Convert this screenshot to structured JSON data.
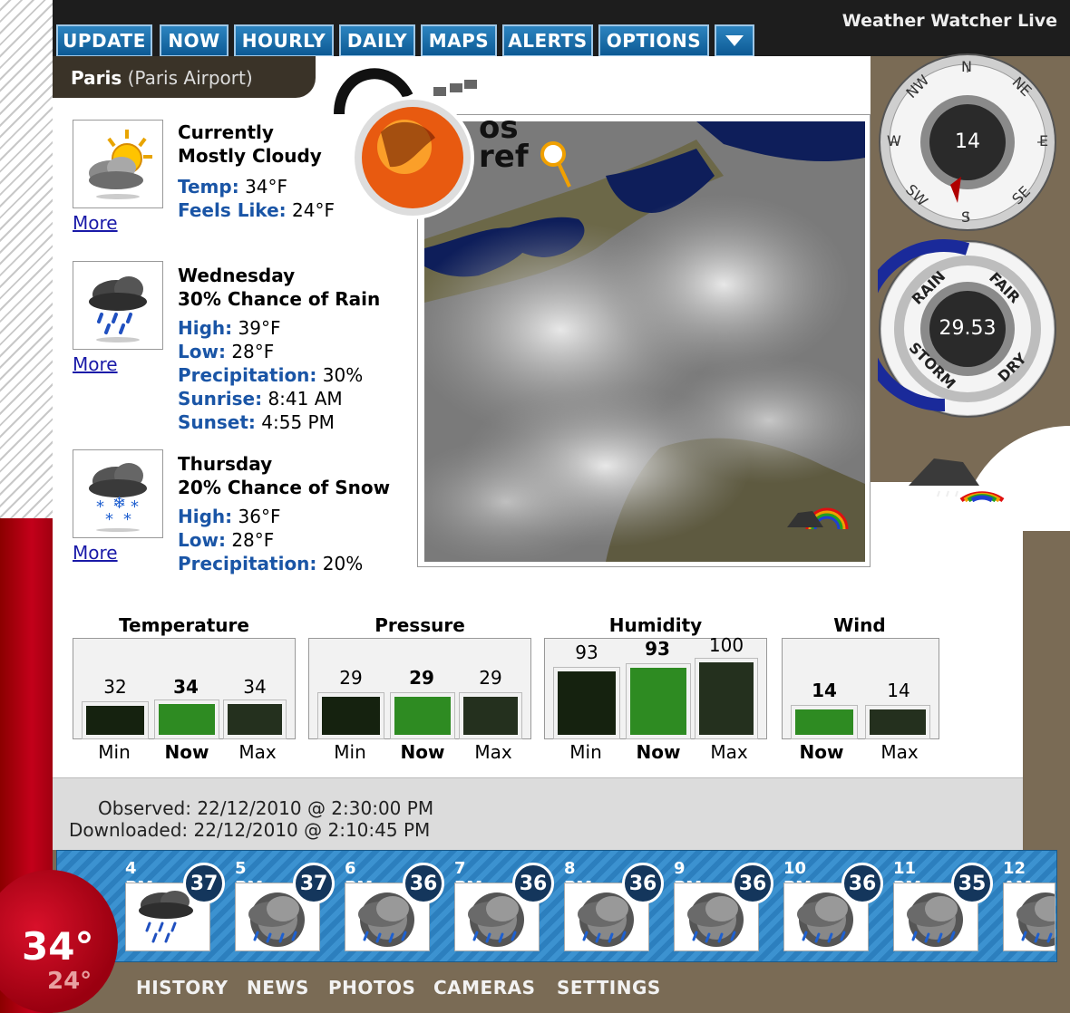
{
  "app": {
    "title": "Weather Watcher Live"
  },
  "nav": {
    "update": "UPDATE",
    "now": "NOW",
    "hourly": "HOURLY",
    "daily": "DAILY",
    "maps": "MAPS",
    "alerts": "ALERTS",
    "options": "OPTIONS"
  },
  "location": {
    "city": "Paris",
    "station": "(Paris Airport)"
  },
  "current": {
    "title": "Currently",
    "condition": "Mostly Cloudy",
    "temp_label": "Temp:",
    "temp": "34°F",
    "feels_label": "Feels Like:",
    "feels": "24°F",
    "more": "More"
  },
  "forecast": [
    {
      "day": "Wednesday",
      "condition": "30% Chance of Rain",
      "high": "39°F",
      "low": "28°F",
      "precip": "30%",
      "sunrise": "8:41 AM",
      "sunset": "4:55 PM",
      "more": "More"
    },
    {
      "day": "Thursday",
      "condition": "20% Chance of Snow",
      "high": "36°F",
      "low": "28°F",
      "precip": "20%",
      "more": "More"
    }
  ],
  "labels": {
    "high": "High:",
    "low": "Low:",
    "precip": "Precipitation:",
    "sunrise": "Sunrise:",
    "sunset": "Sunset:"
  },
  "compass": {
    "n": "N",
    "ne": "NE",
    "e": "E",
    "se": "SE",
    "s": "S",
    "sw": "SW",
    "w": "W",
    "nw": "NW",
    "speed": "14"
  },
  "barometer": {
    "rain": "RAIN",
    "fair": "FAIR",
    "storm": "STORM",
    "dry": "DRY",
    "value": "29.53"
  },
  "stats": {
    "temperature": {
      "title": "Temperature",
      "min": "32",
      "now": "34",
      "max": "34"
    },
    "pressure": {
      "title": "Pressure",
      "min": "29",
      "now": "29",
      "max": "29"
    },
    "humidity": {
      "title": "Humidity",
      "min": "93",
      "now": "93",
      "max": "100"
    },
    "wind": {
      "title": "Wind",
      "now": "14",
      "max": "14"
    },
    "min_label": "Min",
    "now_label": "Now",
    "max_label": "Max"
  },
  "observed": {
    "observed": "Observed: 22/12/2010 @ 2:30:00 PM",
    "downloaded": "Downloaded: 22/12/2010 @ 2:10:45 PM"
  },
  "hourly": [
    {
      "time": "4 PM",
      "temp": "37"
    },
    {
      "time": "5 PM",
      "temp": "37"
    },
    {
      "time": "6 PM",
      "temp": "36"
    },
    {
      "time": "7 PM",
      "temp": "36"
    },
    {
      "time": "8 PM",
      "temp": "36"
    },
    {
      "time": "9 PM",
      "temp": "36"
    },
    {
      "time": "10 PM",
      "temp": "36"
    },
    {
      "time": "11 PM",
      "temp": "35"
    },
    {
      "time": "12 AM",
      "temp": ""
    }
  ],
  "thermo": {
    "temp": "34°",
    "feels": "24°"
  },
  "bottom_nav": {
    "history": "HISTORY",
    "news": "NEWS",
    "photos": "PHOTOS",
    "cameras": "CAMERAS",
    "settings": "SETTINGS"
  },
  "colors": {
    "accent": "#1a55a6",
    "nav": "#0d5a94",
    "bar_now": "#2e8b22",
    "bar_dark": "#1a2a14",
    "thermo": "#c3001a"
  }
}
